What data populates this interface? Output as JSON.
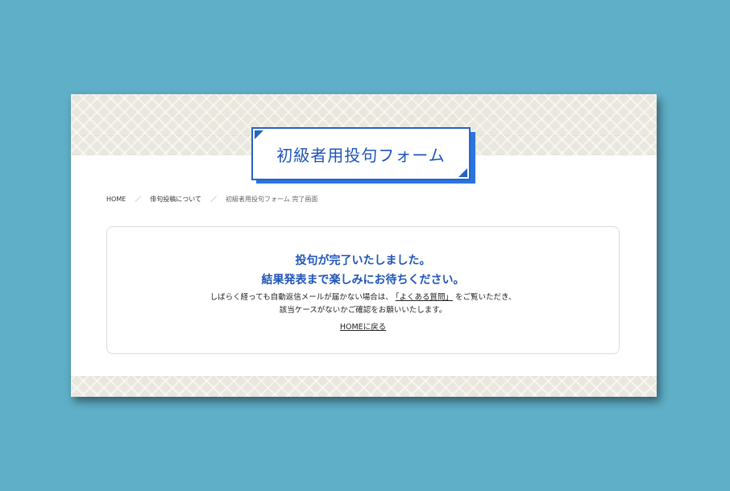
{
  "header": {
    "title": "初級者用投句フォーム"
  },
  "breadcrumb": {
    "home": "HOME",
    "separator": "／",
    "parent": "俳句投稿について",
    "current": "初級者用投句フォーム 完了画面"
  },
  "message": {
    "line1": "投句が完了いたしました。",
    "line2": "結果発表まで楽しみにお待ちください。",
    "body_before_link": "しばらく経っても自動返信メールが届かない場合は、",
    "faq_link": "「よくある質問」",
    "body_after_link": "をご覧いただき、",
    "body_line2": "該当ケースがないかご確認をお願いいたします。",
    "home_link": "HOMEに戻る"
  },
  "colors": {
    "background": "#5eafc7",
    "accent": "#2563c9",
    "title_text": "#1f55b8"
  }
}
